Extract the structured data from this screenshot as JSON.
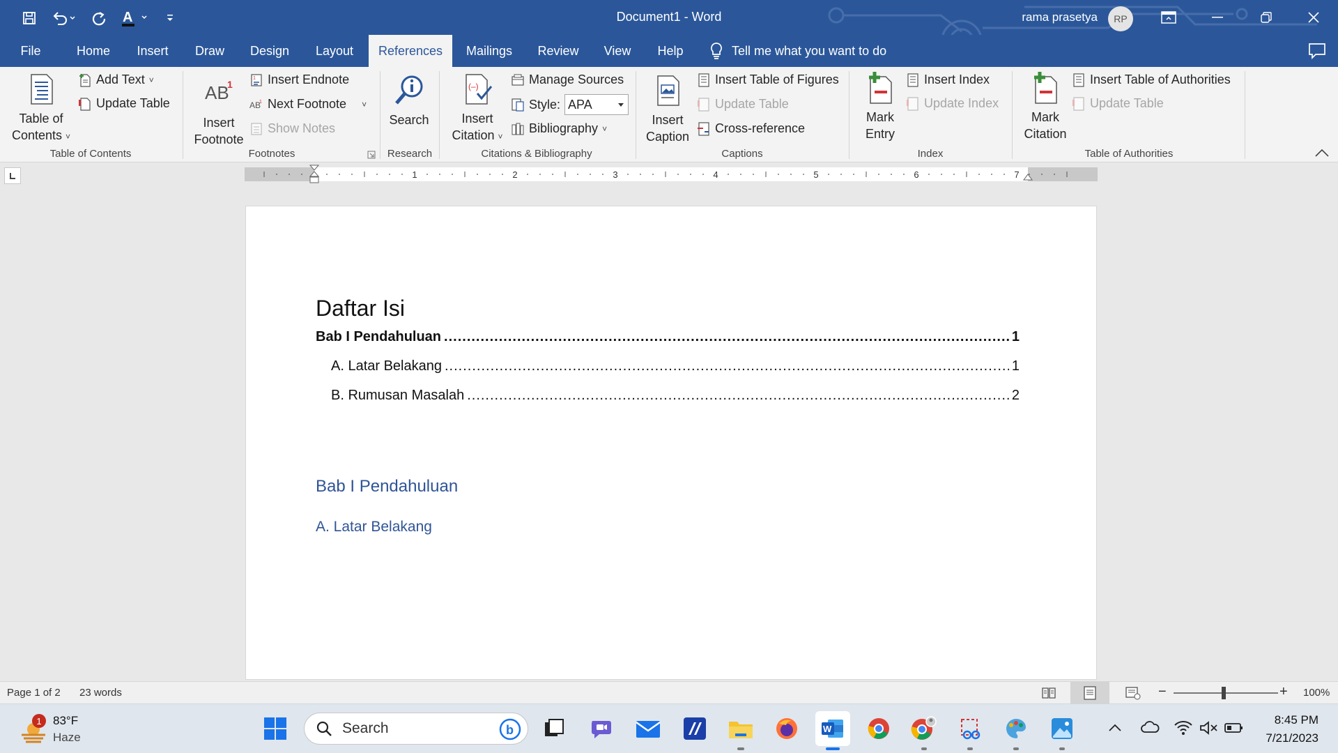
{
  "window": {
    "title": "Document1  -  Word",
    "user_name": "rama prasetya",
    "user_initials": "RP"
  },
  "tabs": [
    {
      "label": "File"
    },
    {
      "label": "Home"
    },
    {
      "label": "Insert"
    },
    {
      "label": "Draw"
    },
    {
      "label": "Design"
    },
    {
      "label": "Layout"
    },
    {
      "label": "References"
    },
    {
      "label": "Mailings"
    },
    {
      "label": "Review"
    },
    {
      "label": "View"
    },
    {
      "label": "Help"
    }
  ],
  "active_tab": "References",
  "tell_me": "Tell me what you want to do",
  "ribbon": {
    "toc": {
      "big_label_1": "Table of",
      "big_label_2": "Contents",
      "add_text": "Add Text",
      "update_table": "Update Table",
      "group": "Table of Contents"
    },
    "footnotes": {
      "insert_footnote_1": "Insert",
      "insert_footnote_2": "Footnote",
      "insert_endnote": "Insert Endnote",
      "next_footnote": "Next Footnote",
      "show_notes": "Show Notes",
      "group": "Footnotes"
    },
    "research": {
      "search": "Search",
      "group": "Research"
    },
    "citations": {
      "insert_citation_1": "Insert",
      "insert_citation_2": "Citation",
      "manage_sources": "Manage Sources",
      "style_label": "Style:",
      "style_value": "APA",
      "bibliography": "Bibliography",
      "group": "Citations & Bibliography"
    },
    "captions": {
      "insert_caption_1": "Insert",
      "insert_caption_2": "Caption",
      "insert_table_of_figures": "Insert Table of Figures",
      "update_table": "Update Table",
      "cross_reference": "Cross-reference",
      "group": "Captions"
    },
    "index": {
      "mark_entry_1": "Mark",
      "mark_entry_2": "Entry",
      "insert_index": "Insert Index",
      "update_index": "Update Index",
      "group": "Index"
    },
    "authorities": {
      "mark_citation_1": "Mark",
      "mark_citation_2": "Citation",
      "insert_table_of_authorities": "Insert Table of Authorities",
      "update_table": "Update Table",
      "group": "Table of Authorities"
    }
  },
  "ruler": {
    "numbers": [
      "1",
      "2",
      "3",
      "4",
      "5",
      "6",
      "7"
    ]
  },
  "document": {
    "toc_heading": "Daftar Isi",
    "toc_entries": [
      {
        "text": "Bab I Pendahuluan",
        "page": "1",
        "level": 1
      },
      {
        "text": "A. Latar Belakang",
        "page": "1",
        "level": 2
      },
      {
        "text": "B. Rumusan Masalah",
        "page": "2",
        "level": 2
      }
    ],
    "heading1": "Bab I Pendahuluan",
    "heading2": "A. Latar Belakang"
  },
  "status": {
    "page": "Page 1 of 2",
    "words": "23 words",
    "zoom": "100%",
    "zoom_level_percent": 100
  },
  "taskbar": {
    "weather_temp": "83°F",
    "weather_desc": "Haze",
    "weather_badge": "1",
    "search_placeholder": "Search",
    "time": "8:45 PM",
    "date": "7/21/2023"
  },
  "colors": {
    "word_blue": "#2b579a",
    "heading_blue": "#2f5496",
    "ribbon_bg": "#f3f3f3",
    "taskbar_bg": "#dfe6ee"
  }
}
